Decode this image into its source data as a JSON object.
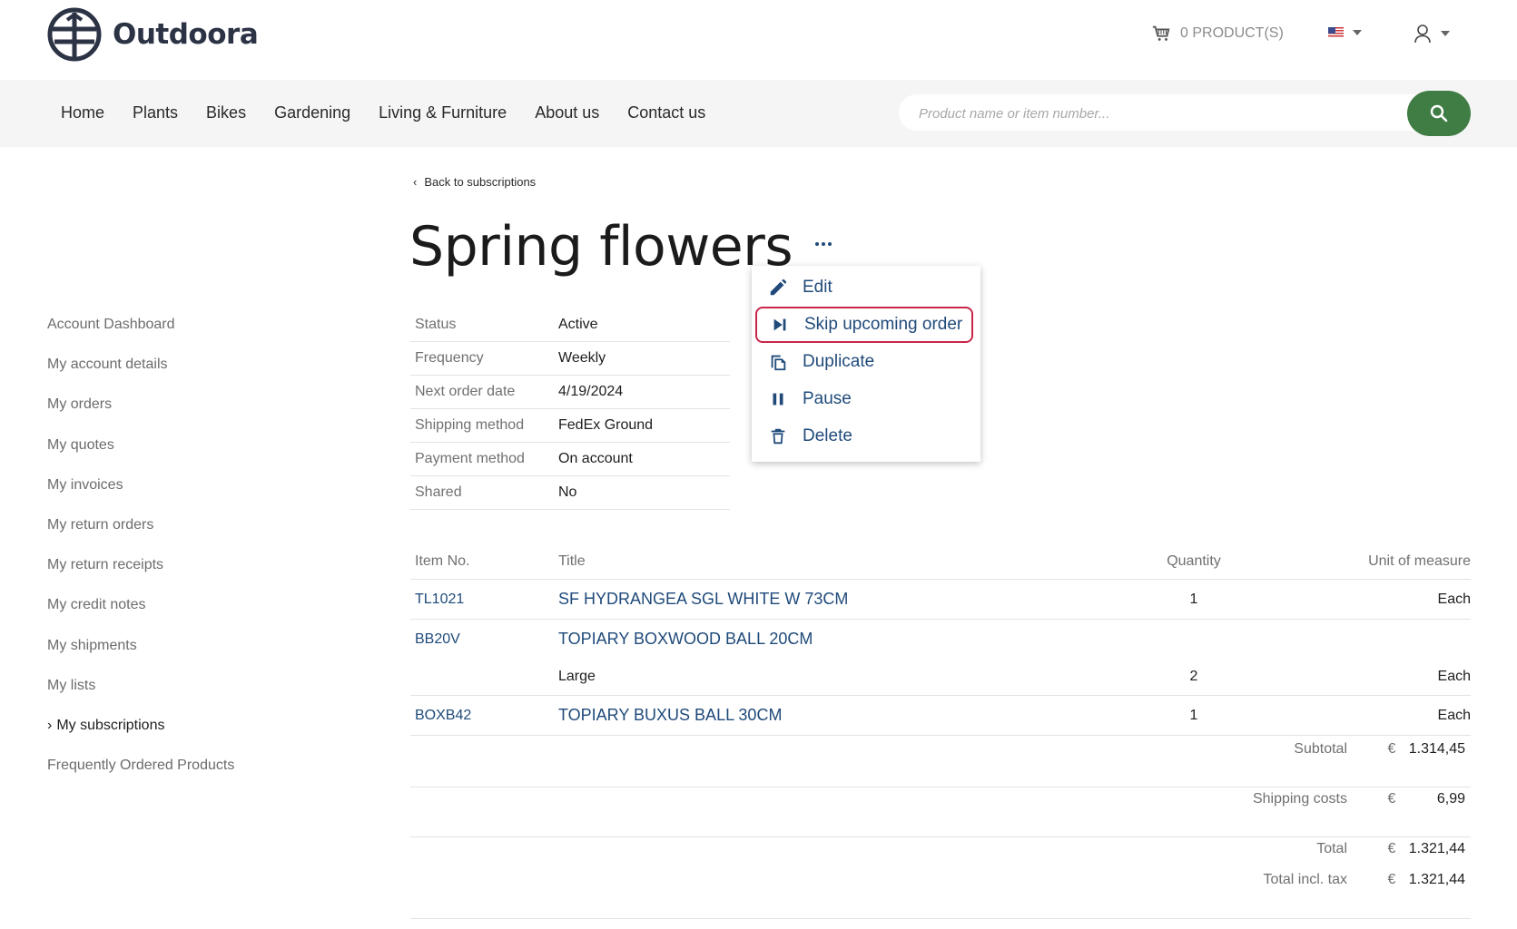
{
  "brand": {
    "name": "Outdoora"
  },
  "header": {
    "cart_label": "0 PRODUCT(S)",
    "language_icon": "us-flag-icon",
    "user_icon": "user-icon"
  },
  "nav": {
    "items": [
      "Home",
      "Plants",
      "Bikes",
      "Gardening",
      "Living & Furniture",
      "About us",
      "Contact us"
    ]
  },
  "search": {
    "placeholder": "Product name or item number..."
  },
  "sidebar": {
    "items": [
      "Account Dashboard",
      "My account details",
      "My orders",
      "My quotes",
      "My invoices",
      "My return orders",
      "My return receipts",
      "My credit notes",
      "My shipments",
      "My lists",
      "My subscriptions",
      "Frequently Ordered Products"
    ],
    "active": "My subscriptions"
  },
  "page": {
    "back_label": "Back to subscriptions",
    "title": "Spring flowers"
  },
  "properties": [
    {
      "label": "Status",
      "value": "Active"
    },
    {
      "label": "Frequency",
      "value": "Weekly"
    },
    {
      "label": "Next order date",
      "value": "4/19/2024"
    },
    {
      "label": "Shipping method",
      "value": "FedEx Ground"
    },
    {
      "label": "Payment method",
      "value": "On account"
    },
    {
      "label": "Shared",
      "value": "No"
    }
  ],
  "actions_menu": {
    "items": [
      {
        "label": "Edit",
        "icon": "pencil-icon"
      },
      {
        "label": "Skip upcoming order",
        "icon": "skip-next-icon",
        "highlighted": true
      },
      {
        "label": "Duplicate",
        "icon": "copy-icon"
      },
      {
        "label": "Pause",
        "icon": "pause-icon"
      },
      {
        "label": "Delete",
        "icon": "trash-icon"
      }
    ]
  },
  "lines": {
    "headers": {
      "item_no": "Item No.",
      "title": "Title",
      "quantity": "Quantity",
      "uom": "Unit of measure"
    },
    "rows": [
      {
        "item_no": "TL1021",
        "title": "SF HYDRANGEA SGL WHITE W 73CM",
        "quantity": "1",
        "uom": "Each"
      },
      {
        "item_no": "BB20V",
        "title": "TOPIARY BOXWOOD BALL 20CM",
        "variant": "Large",
        "quantity": "2",
        "uom": "Each"
      },
      {
        "item_no": "BOXB42",
        "title": "TOPIARY BUXUS BALL 30CM",
        "quantity": "1",
        "uom": "Each"
      }
    ]
  },
  "totals": {
    "currency": "€",
    "subtotal_label": "Subtotal",
    "subtotal": "1.314,45",
    "shipping_label": "Shipping costs",
    "shipping": "6,99",
    "total_label": "Total",
    "total": "1.321,44",
    "total_tax_label": "Total incl. tax",
    "total_tax": "1.321,44"
  },
  "colors": {
    "accent_green": "#3f7d45",
    "link_blue": "#1f4a7a",
    "highlight_red": "#c8264b"
  }
}
